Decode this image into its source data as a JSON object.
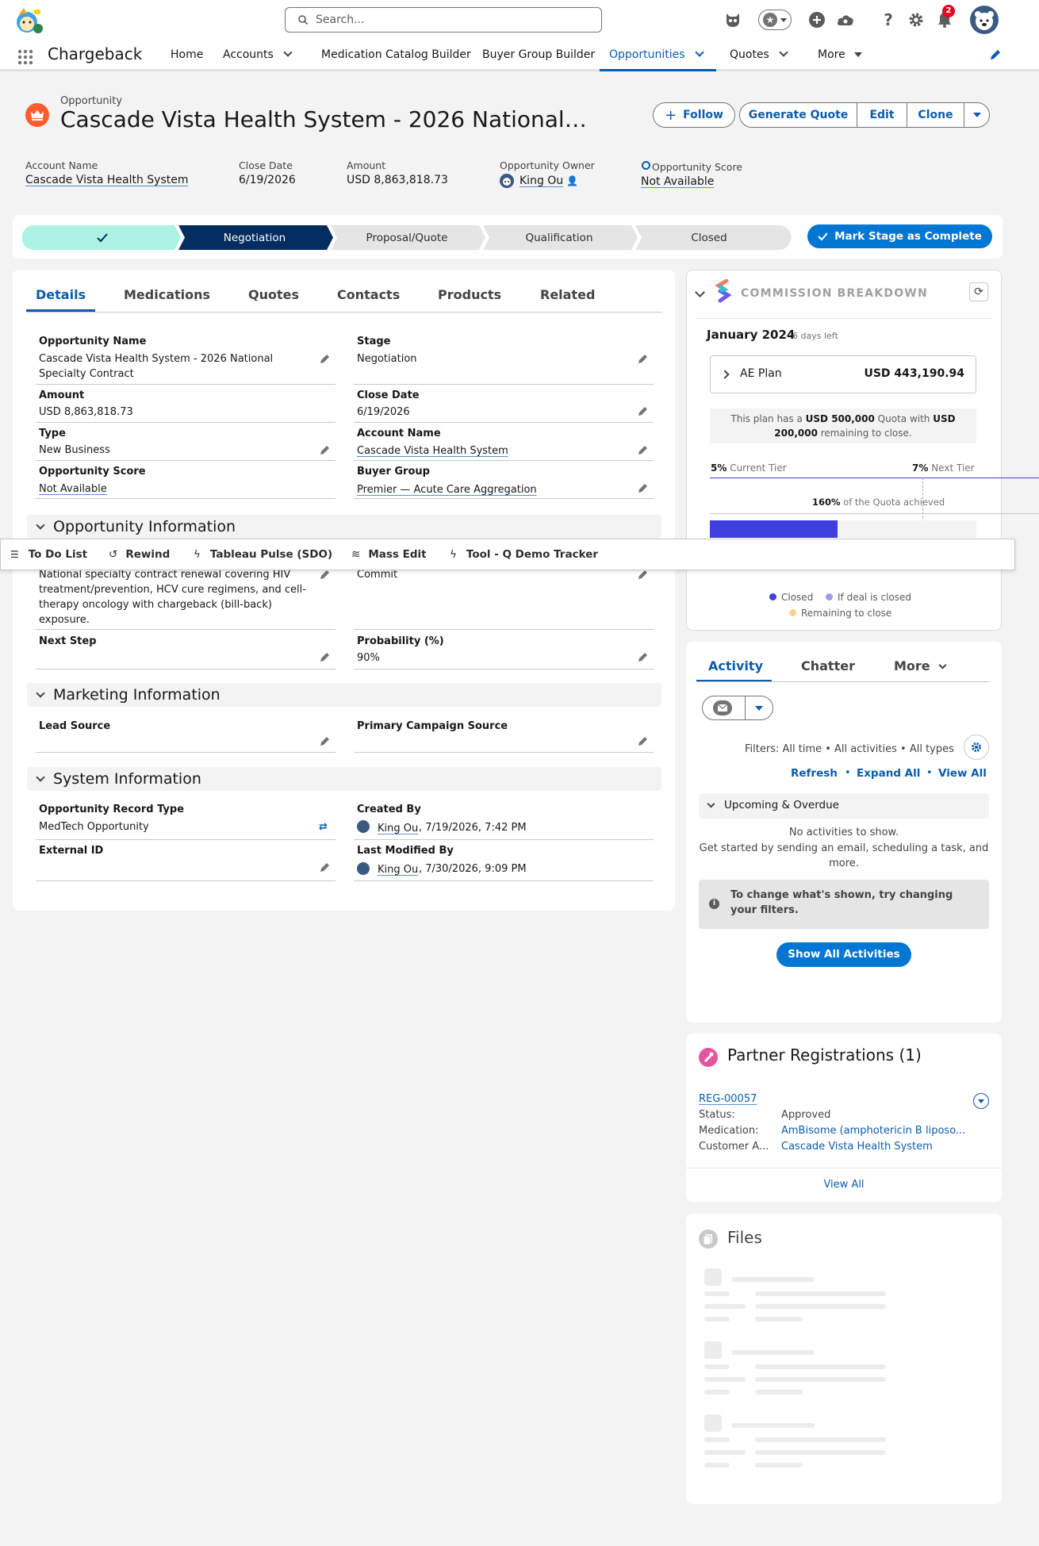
{
  "header": {
    "search_placeholder": "Search...",
    "notification_count": "2",
    "icons": [
      "astro-app-icon",
      "einstein-icon",
      "favorites-star-icon",
      "add-icon",
      "setup-cloud-icon",
      "help-icon",
      "gear-icon",
      "bell-icon",
      "avatar"
    ]
  },
  "nav": {
    "app_name": "Chargeback",
    "items": [
      {
        "label": "Home"
      },
      {
        "label": "Accounts"
      },
      {
        "label": "Medication Catalog Builder"
      },
      {
        "label": "Buyer Group Builder"
      },
      {
        "label": "Opportunities"
      },
      {
        "label": "Quotes"
      },
      {
        "label": "More"
      }
    ]
  },
  "record": {
    "object_label": "Opportunity",
    "title": "Cascade Vista Health System - 2026 National…",
    "buttons": {
      "follow": "Follow",
      "generate_quote": "Generate Quote",
      "edit": "Edit",
      "clone": "Clone"
    },
    "highlights": [
      {
        "label": "Account Name",
        "value": "Cascade Vista Health System"
      },
      {
        "label": "Close Date",
        "value": "6/19/2026"
      },
      {
        "label": "Amount",
        "value": "USD 8,863,818.73"
      },
      {
        "label": "Opportunity Owner",
        "value": "King Ou"
      },
      {
        "label": "Opportunity Score",
        "value": "Not Available"
      }
    ]
  },
  "path": {
    "steps": [
      "Negotiation",
      "Proposal/Quote",
      "Qualification",
      "Closed"
    ],
    "mark_complete": "Mark Stage as Complete"
  },
  "tabs": [
    "Details",
    "Medications",
    "Quotes",
    "Contacts",
    "Products",
    "Related"
  ],
  "details": {
    "opportunity_name_label": "Opportunity Name",
    "opportunity_name_line1": "Cascade Vista Health System - 2026 National",
    "opportunity_name_line2": "Specialty Contract",
    "stage_label": "Stage",
    "stage": "Negotiation",
    "amount_label": "Amount",
    "amount": "USD 8,863,818.73",
    "close_date_label": "Close Date",
    "close_date": "6/19/2026",
    "type_label": "Type",
    "type": "New Business",
    "account_name_label": "Account Name",
    "account_name": "Cascade Vista Health System",
    "score_label": "Opportunity Score",
    "score": "Not Available",
    "buyer_group_label": "Buyer Group",
    "buyer_group": "Premier — Acute Care Aggregation"
  },
  "sections": {
    "opp_info": "Opportunity Information",
    "marketing": "Marketing Information",
    "system": "System Information"
  },
  "opp_info": {
    "description_lines": [
      "National specialty contract renewal covering HIV",
      "treatment/prevention, HCV cure regimens, and cell-",
      "therapy oncology with chargeback (bill-back)",
      "exposure."
    ],
    "forecast": "Commit",
    "next_step_label": "Next Step",
    "probability_label": "Probability (%)",
    "probability": "90%"
  },
  "marketing": {
    "lead_source_label": "Lead Source",
    "campaign_label": "Primary Campaign Source"
  },
  "system": {
    "record_type_label": "Opportunity Record Type",
    "record_type": "MedTech Opportunity",
    "created_by_label": "Created By",
    "created_by_name": "King Ou",
    "created_by_date": ", 7/19/2026, 7:42 PM",
    "external_id_label": "External ID",
    "modified_by_label": "Last Modified By",
    "modified_by_name": "King Ou",
    "modified_by_date": ", 7/30/2026, 9:09 PM"
  },
  "utility_bar": [
    "To Do List",
    "Rewind",
    "Tableau Pulse (SDO)",
    "Mass Edit",
    "Tool - Q Demo Tracker"
  ],
  "commission": {
    "title": "COMMISSION BREAKDOWN",
    "month": "January 2024",
    "days_left": "6 days left",
    "plan_name": "AE Plan",
    "plan_amount": "USD 443,190.94",
    "quota_text_a": "This plan has a ",
    "quota_amount": "USD 500,000",
    "quota_text_b": " Quota with ",
    "remaining_amount_a": "USD",
    "remaining_amount_b": "200,000",
    "quota_text_c": " remaining to close.",
    "current_tier_pct": "5%",
    "current_tier_label": " Current Tier",
    "next_tier_pct": "7%",
    "next_tier_label": " Next Tier",
    "achieved_pct": "160%",
    "achieved_label": " of the Quota achieved",
    "bar_fill_fraction": 0.48,
    "legend": [
      "Closed",
      "If deal is closed",
      "Remaining to close"
    ],
    "colors": {
      "closed": "#3f3fe0",
      "if_closed": "#9b9bf5",
      "remaining": "#ffd289"
    }
  },
  "activity": {
    "tabs": [
      "Activity",
      "Chatter",
      "More"
    ],
    "filters": "Filters: All time • All activities • All types",
    "refresh": "Refresh",
    "expand_all": "Expand All",
    "view_all": "View All",
    "upcoming": "Upcoming & Overdue",
    "no_activities": "No activities to show.",
    "get_started_1": "Get started by sending an email, scheduling a task, and",
    "get_started_2": "more.",
    "hint_1": "To change what's shown, try changing",
    "hint_2": "your filters.",
    "show_all": "Show All Activities"
  },
  "partner": {
    "title": "Partner Registrations",
    "count": "(1)",
    "reg_id": "REG-00057",
    "status_label": "Status:",
    "status": "Approved",
    "medication_label": "Medication:",
    "medication": "AmBisome (amphotericin B liposo...",
    "customer_label": "Customer A...",
    "customer": "Cascade Vista Health System",
    "view_all": "View All"
  },
  "files": {
    "title": "Files"
  },
  "colors": {
    "brand": "#0b5cab",
    "path_complete": "#acf3e4",
    "path_current": "#032d60",
    "button_brand": "#0176d3"
  }
}
